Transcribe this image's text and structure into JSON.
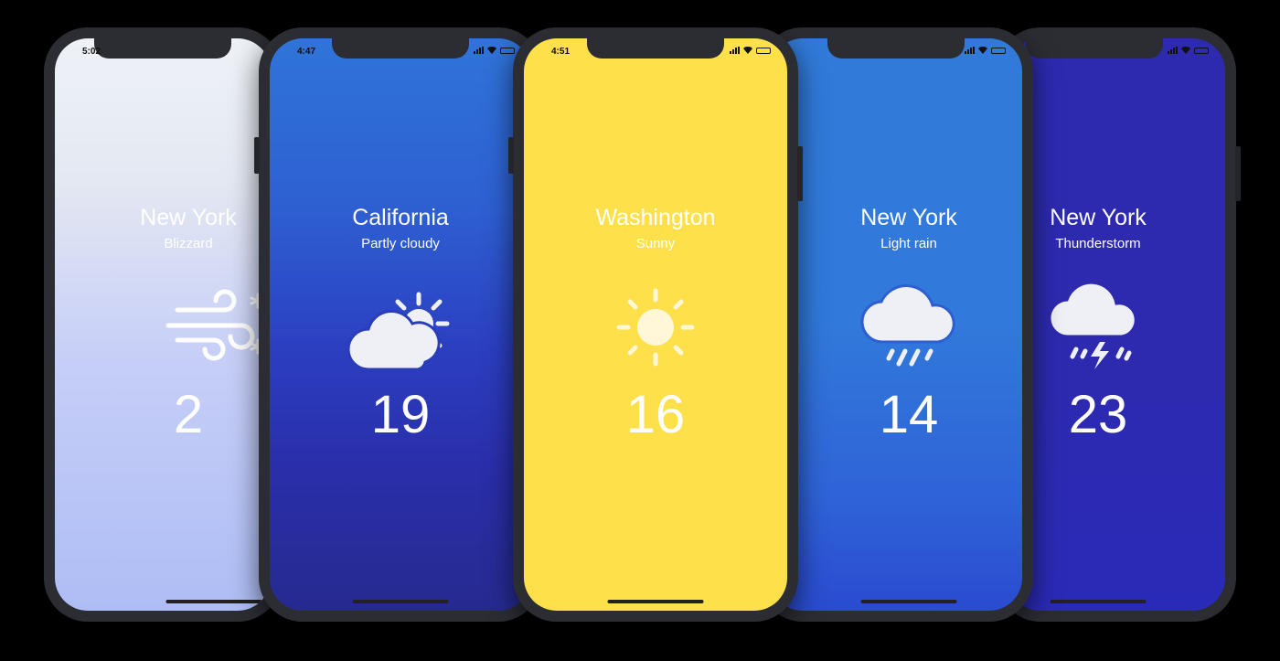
{
  "phones": [
    {
      "time": "5:02",
      "city": "New York",
      "condition": "Blizzard",
      "temperature": "2",
      "icon": "wind-snow-icon",
      "colors": {
        "top": "#eef2f7",
        "bottom": "#aebdf5",
        "text": "#ffffff"
      }
    },
    {
      "time": "4:47",
      "city": "California",
      "condition": "Partly cloudy",
      "temperature": "19",
      "icon": "partly-cloudy-icon",
      "colors": {
        "top": "#2f74d9",
        "bottom": "#2a2eaa",
        "text": "#ffffff"
      }
    },
    {
      "time": "4:51",
      "city": "Washington",
      "condition": "Sunny",
      "temperature": "16",
      "icon": "sun-icon",
      "colors": {
        "top": "#fde04a",
        "bottom": "#fde04a",
        "text": "#ffffff"
      }
    },
    {
      "time": "",
      "city": "New York",
      "condition": "Light rain",
      "temperature": "14",
      "icon": "rain-cloud-icon",
      "colors": {
        "top": "#317ad9",
        "bottom": "#2f5fd8",
        "text": "#ffffff"
      }
    },
    {
      "time": "",
      "city": "New York",
      "condition": "Thunderstorm",
      "temperature": "23",
      "icon": "thunderstorm-icon",
      "colors": {
        "top": "#2d2ab0",
        "bottom": "#2a2ab8",
        "text": "#ffffff"
      }
    }
  ]
}
